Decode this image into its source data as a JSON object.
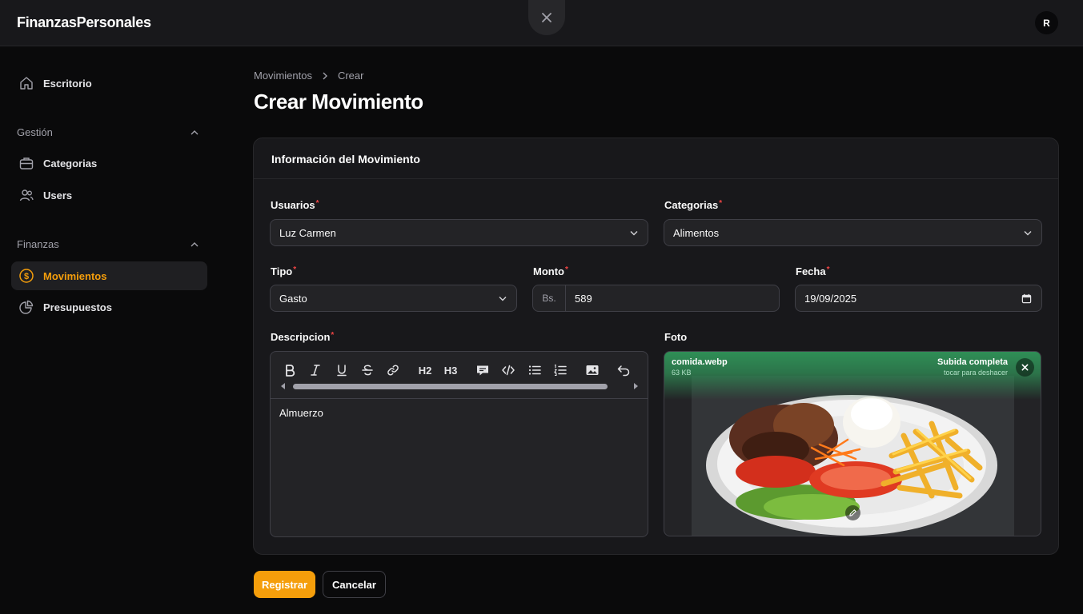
{
  "app": {
    "brand": "FinanzasPersonales",
    "avatar_initial": "R"
  },
  "sidebar": {
    "dashboard": "Escritorio",
    "groups": [
      {
        "label": "Gestión",
        "items": [
          "Categorias",
          "Users"
        ]
      },
      {
        "label": "Finanzas",
        "items": [
          "Movimientos",
          "Presupuestos"
        ]
      }
    ],
    "active_item": "Movimientos"
  },
  "breadcrumb": {
    "parent": "Movimientos",
    "current": "Crear"
  },
  "page": {
    "title": "Crear Movimiento"
  },
  "form": {
    "section_title": "Información del Movimiento",
    "required_mark": "*",
    "usuarios": {
      "label": "Usuarios",
      "value": "Luz Carmen"
    },
    "categorias": {
      "label": "Categorias",
      "value": "Alimentos"
    },
    "tipo": {
      "label": "Tipo",
      "value": "Gasto"
    },
    "monto": {
      "label": "Monto",
      "prefix": "Bs.",
      "value": "589"
    },
    "fecha": {
      "label": "Fecha",
      "value": "19/09/2025"
    },
    "descripcion": {
      "label": "Descripcion",
      "value": "Almuerzo"
    },
    "foto": {
      "label": "Foto",
      "file_name": "comida.webp",
      "file_size": "63 KB",
      "status": "Subida completa",
      "undo_hint": "tocar para deshacer"
    }
  },
  "editor_toolbar": {
    "h2": "H2",
    "h3": "H3"
  },
  "actions": {
    "submit": "Registrar",
    "cancel": "Cancelar"
  },
  "colors": {
    "accent": "#f59e0b",
    "upload_success": "#2f8f56",
    "required": "#ef4444"
  }
}
